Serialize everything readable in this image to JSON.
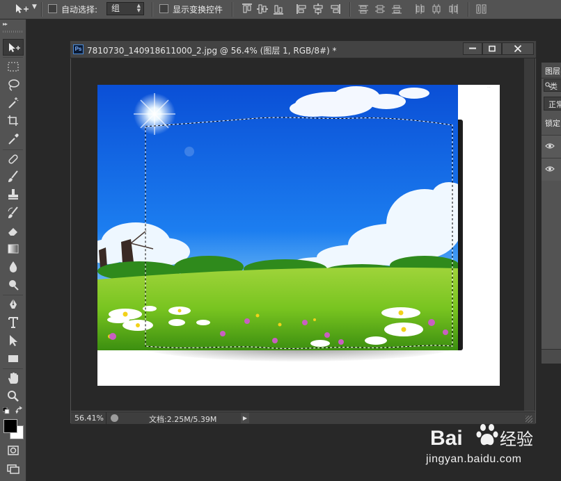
{
  "options_bar": {
    "auto_select_label": "自动选择:",
    "auto_select_checked": false,
    "auto_select_mode": "组",
    "show_transform_label": "显示变换控件",
    "show_transform_checked": false
  },
  "document": {
    "title": "7810730_140918611000_2.jpg @ 56.4% (图层 1, RGB/8#) *",
    "ps_badge": "Ps",
    "zoom": "56.41%",
    "doc_size": "文档:2.25M/5.39M"
  },
  "layers_panel": {
    "tab_label": "图层",
    "filter_label": "类",
    "blend_mode": "正常",
    "lock_label": "锁定"
  },
  "colors": {
    "foreground": "#000000",
    "background": "#ffffff",
    "ui_panel": "#535353",
    "ui_canvas": "#282828"
  },
  "watermark": {
    "logo_text": "Bai经验",
    "url": "jingyan.baidu.com"
  }
}
